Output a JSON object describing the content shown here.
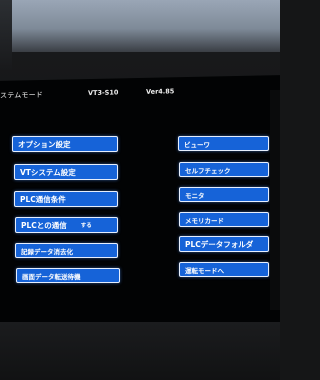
{
  "header": {
    "title": "ステムモード",
    "model": "VT3-S10",
    "version": "Ver4.85"
  },
  "left_buttons": [
    {
      "label": "オプション設定"
    },
    {
      "label": "VTシステム設定"
    },
    {
      "label": "PLC通信条件"
    },
    {
      "label": "PLCとの通信",
      "suffix": "する"
    },
    {
      "label": "記録データ消去化"
    },
    {
      "label": "画面データ転送待機"
    }
  ],
  "right_buttons": [
    {
      "label": "ビューワ"
    },
    {
      "label": "セルフチェック"
    },
    {
      "label": "モニタ"
    },
    {
      "label": "メモリカード"
    },
    {
      "label": "PLCデータフォルダ"
    },
    {
      "label": "運転モードへ"
    }
  ],
  "colors": {
    "button_fill": "#1663d8",
    "button_border": "#e6eefc",
    "screen_bg": "#020304"
  }
}
